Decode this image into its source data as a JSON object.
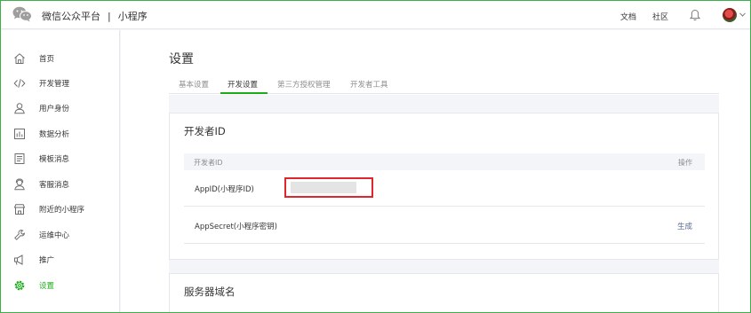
{
  "header": {
    "brand": "微信公众平台",
    "separator": "|",
    "product": "小程序",
    "links": {
      "docs": "文档",
      "community": "社区"
    },
    "icons": {
      "logo": "wechat-logo-icon",
      "bell": "bell-icon",
      "caret": "chevron-down-icon"
    }
  },
  "sidebar": {
    "items": [
      {
        "label": "首页",
        "icon": "home-icon"
      },
      {
        "label": "开发管理",
        "icon": "code-icon"
      },
      {
        "label": "用户身份",
        "icon": "user-icon"
      },
      {
        "label": "数据分析",
        "icon": "bar-chart-icon"
      },
      {
        "label": "模板消息",
        "icon": "template-message-icon"
      },
      {
        "label": "客服消息",
        "icon": "customer-service-icon"
      },
      {
        "label": "附近的小程序",
        "icon": "store-icon"
      },
      {
        "label": "运维中心",
        "icon": "wrench-icon"
      },
      {
        "label": "推广",
        "icon": "megaphone-icon"
      },
      {
        "label": "设置",
        "icon": "gear-icon",
        "active": true
      }
    ]
  },
  "main": {
    "title": "设置",
    "tabs": [
      {
        "label": "基本设置"
      },
      {
        "label": "开发设置",
        "active": true
      },
      {
        "label": "第三方授权管理"
      },
      {
        "label": "开发者工具"
      }
    ],
    "developer_id": {
      "title": "开发者ID",
      "columns": {
        "name": "开发者ID",
        "action": "操作"
      },
      "rows": [
        {
          "label": "AppID(小程序ID)",
          "value": "",
          "action": ""
        },
        {
          "label": "AppSecret(小程序密钥)",
          "value": "",
          "action": "生成"
        }
      ]
    },
    "server_domain": {
      "title": "服务器域名"
    }
  },
  "colors": {
    "accent": "#1aad19",
    "link": "#576b95",
    "highlight_border": "#e0262b",
    "frame_border": "#3cb04a"
  }
}
